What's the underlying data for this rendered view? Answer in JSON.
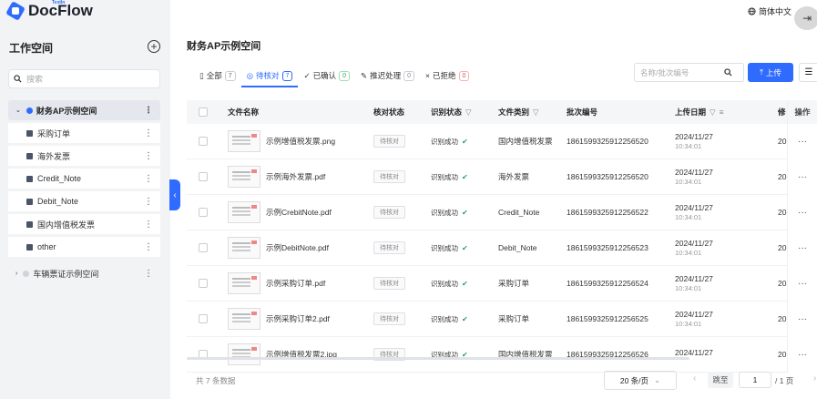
{
  "app": {
    "logo_sup": "TextIn",
    "logo_text": "DocFlow"
  },
  "sidebar": {
    "title": "工作空间",
    "add_icon": "plus-circle-icon",
    "search_placeholder": "搜索",
    "root": {
      "label": "财务AP示例空间"
    },
    "items": [
      {
        "label": "采购订单"
      },
      {
        "label": "海外发票"
      },
      {
        "label": "Credit_Note"
      },
      {
        "label": "Debit_Note"
      },
      {
        "label": "国内增值税发票"
      },
      {
        "label": "other"
      }
    ],
    "root2": {
      "label": "车辆票证示例空间"
    }
  },
  "header": {
    "lang": "简体中文"
  },
  "page_title": "财务AP示例空间",
  "tabs": [
    {
      "label": "全部",
      "count": "7"
    },
    {
      "label": "待核对",
      "count": "7"
    },
    {
      "label": "已确认",
      "count": "0"
    },
    {
      "label": "推迟处理",
      "count": "0"
    },
    {
      "label": "已拒绝",
      "count": "0"
    }
  ],
  "search_placeholder": "名称/批次编号",
  "upload_label": "上传",
  "columns": {
    "name": "文件名称",
    "verify": "核对状态",
    "recog": "识别状态",
    "type": "文件类别",
    "batch": "批次编号",
    "date": "上传日期",
    "mod": "修",
    "ops": "操作"
  },
  "rows": [
    {
      "name": "示例增值税发票.png",
      "verify": "待核对",
      "recog": "识别成功",
      "type": "国内增值税发票",
      "batch": "1861599325912256520",
      "date": "2024/11/27",
      "time": "10:34:01",
      "mod": "20"
    },
    {
      "name": "示例海外发票.pdf",
      "verify": "待核对",
      "recog": "识别成功",
      "type": "海外发票",
      "batch": "1861599325912256520",
      "date": "2024/11/27",
      "time": "10:34:01",
      "mod": "20"
    },
    {
      "name": "示例CrebitNote.pdf",
      "verify": "待核对",
      "recog": "识别成功",
      "type": "Credit_Note",
      "batch": "1861599325912256522",
      "date": "2024/11/27",
      "time": "10:34:01",
      "mod": "20"
    },
    {
      "name": "示例DebitNote.pdf",
      "verify": "待核对",
      "recog": "识别成功",
      "type": "Debit_Note",
      "batch": "1861599325912256523",
      "date": "2024/11/27",
      "time": "10:34:01",
      "mod": "20"
    },
    {
      "name": "示例采购订单.pdf",
      "verify": "待核对",
      "recog": "识别成功",
      "type": "采购订单",
      "batch": "1861599325912256524",
      "date": "2024/11/27",
      "time": "10:34:01",
      "mod": "20"
    },
    {
      "name": "示例采购订单2.pdf",
      "verify": "待核对",
      "recog": "识别成功",
      "type": "采购订单",
      "batch": "1861599325912256525",
      "date": "2024/11/27",
      "time": "10:34:01",
      "mod": "20"
    },
    {
      "name": "示例增值税发票2.jpg",
      "verify": "待核对",
      "recog": "识别成功",
      "type": "国内增值税发票",
      "batch": "1861599325912256526",
      "date": "2024/11/27",
      "time": "",
      "mod": "20"
    }
  ],
  "footer": {
    "total": "共 7 条数据",
    "page_size": "20 条/页",
    "jump": "跳至",
    "page": "1",
    "pages": "/ 1 页"
  }
}
